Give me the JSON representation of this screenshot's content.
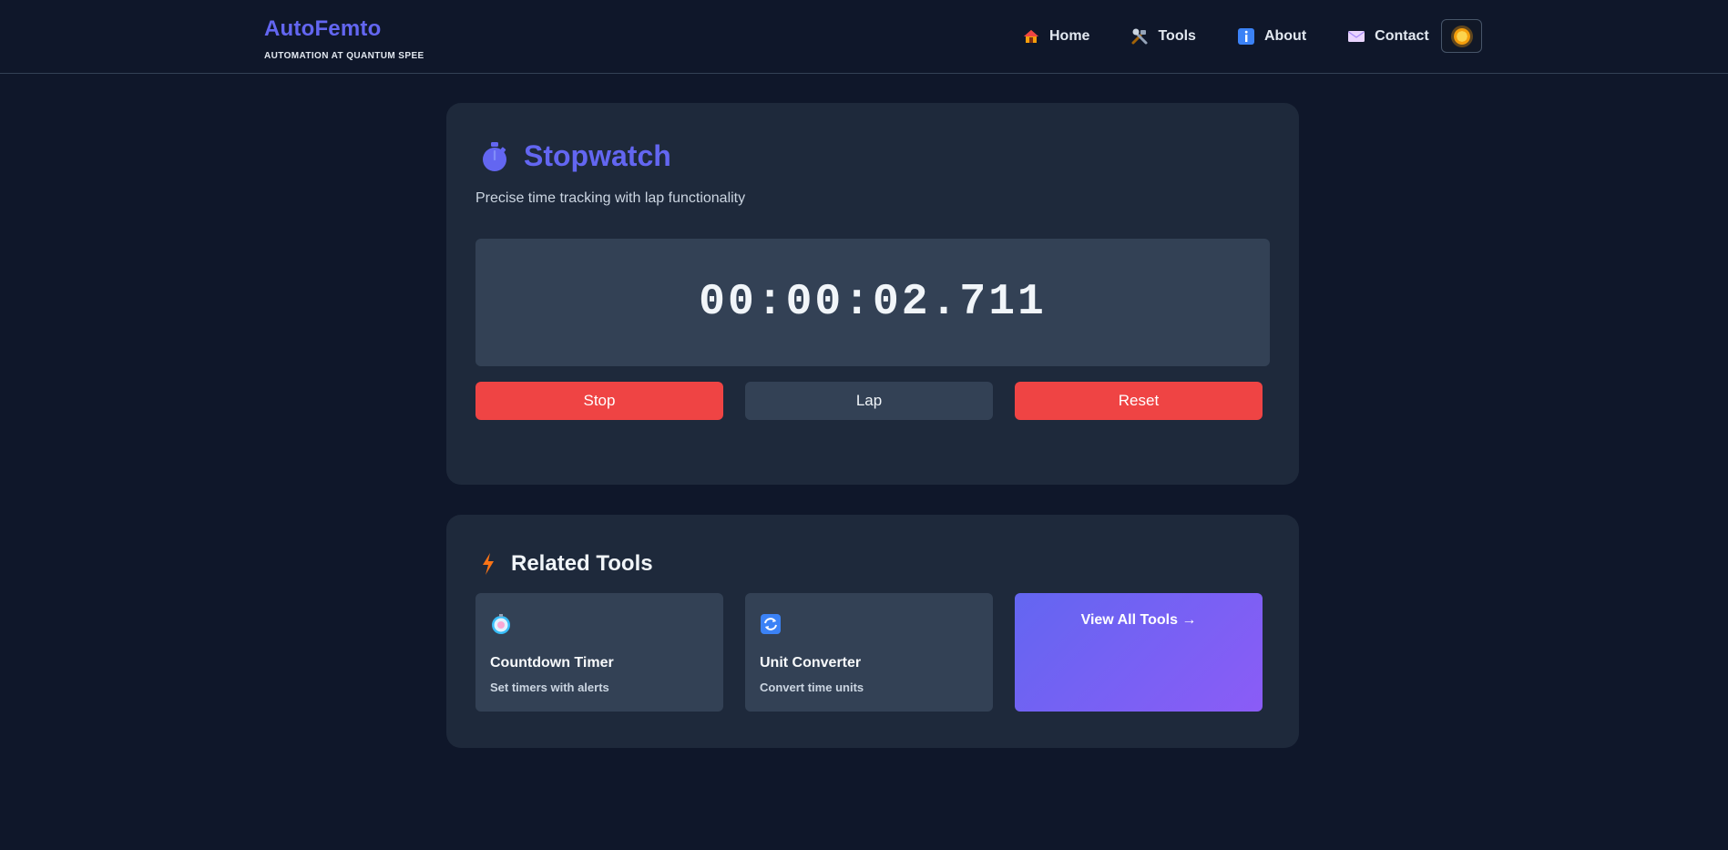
{
  "header": {
    "brand_title": "AutoFemto",
    "brand_subtitle": "AUTOMATION AT QUANTUM SPEE",
    "nav": [
      {
        "label": "Home",
        "icon": "house-icon"
      },
      {
        "label": "Tools",
        "icon": "tools-icon"
      },
      {
        "label": "About",
        "icon": "info-icon"
      },
      {
        "label": "Contact",
        "icon": "envelope-icon"
      }
    ],
    "theme_toggle_icon": "sun-icon"
  },
  "stopwatch": {
    "icon": "stopwatch-icon",
    "title": "Stopwatch",
    "description": "Precise time tracking with lap functionality",
    "time": "00:00:02.711",
    "buttons": {
      "stop": "Stop",
      "lap": "Lap",
      "reset": "Reset"
    }
  },
  "related": {
    "icon": "lightning-icon",
    "title": "Related Tools",
    "tools": [
      {
        "name": "Countdown Timer",
        "description": "Set timers with alerts",
        "icon": "timer-icon"
      },
      {
        "name": "Unit Converter",
        "description": "Convert time units",
        "icon": "refresh-icon"
      }
    ],
    "view_all": "View All Tools →"
  },
  "colors": {
    "background": "#0f172a",
    "card": "#1e293b",
    "accent": "#6366f1",
    "danger": "#ef4444",
    "muted": "#334155"
  }
}
